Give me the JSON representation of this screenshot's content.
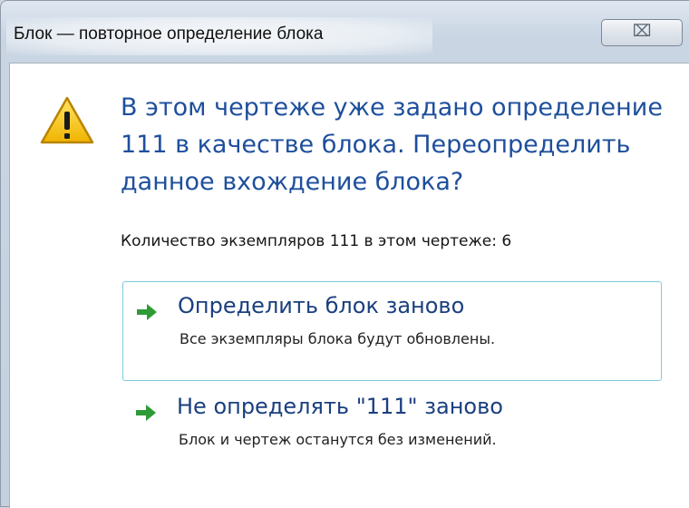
{
  "window": {
    "title": "Блок — повторное определение блока",
    "close_glyph": "⌧"
  },
  "dialog": {
    "icon": "warning-icon",
    "main_instruction_lines": [
      "В этом чертеже уже задано определение",
      "111 в качестве блока. Переопределить",
      "данное вхождение блока?"
    ],
    "info": "Количество экземпляров 111 в этом чертеже: 6",
    "commands": [
      {
        "icon": "green-arrow-icon",
        "title": "Определить блок заново",
        "note": "Все экземпляры блока будут обновлены."
      },
      {
        "icon": "green-arrow-icon",
        "title": "Не определять \"111\" заново",
        "note": "Блок и чертеж останутся без изменений."
      }
    ]
  },
  "colors": {
    "instruction_text": "#1e4f9c",
    "command_title": "#1b3f7f",
    "arrow_green": "#2e9b37",
    "focus_border": "#7ec9dd",
    "warning_yellow": "#f5c400"
  }
}
